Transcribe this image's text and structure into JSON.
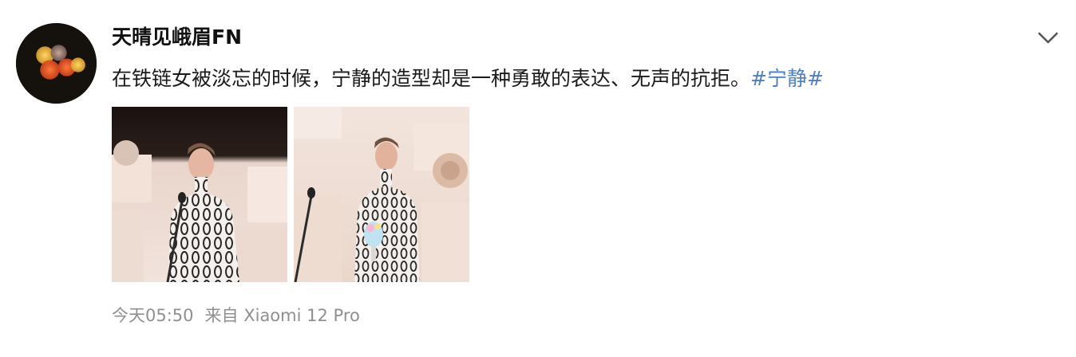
{
  "post": {
    "author": "天晴见峨眉FN",
    "text": "在铁链女被淡忘的时候，宁静的造型却是一种勇敢的表达、无声的抗拒。",
    "hashtag": "#宁静#",
    "timestamp": "今天05:50",
    "source_prefix": "来自",
    "source_device": "Xiaomi 12 Pro",
    "menu_icon": "chevron-down-icon",
    "images": [
      {
        "name": "photo-1",
        "description_icon": "photo"
      },
      {
        "name": "photo-2",
        "description_icon": "photo"
      }
    ]
  },
  "colors": {
    "hashtag": "#4d7fc5",
    "meta_text": "#8f8f8f",
    "body_text": "#1a1a1a"
  }
}
